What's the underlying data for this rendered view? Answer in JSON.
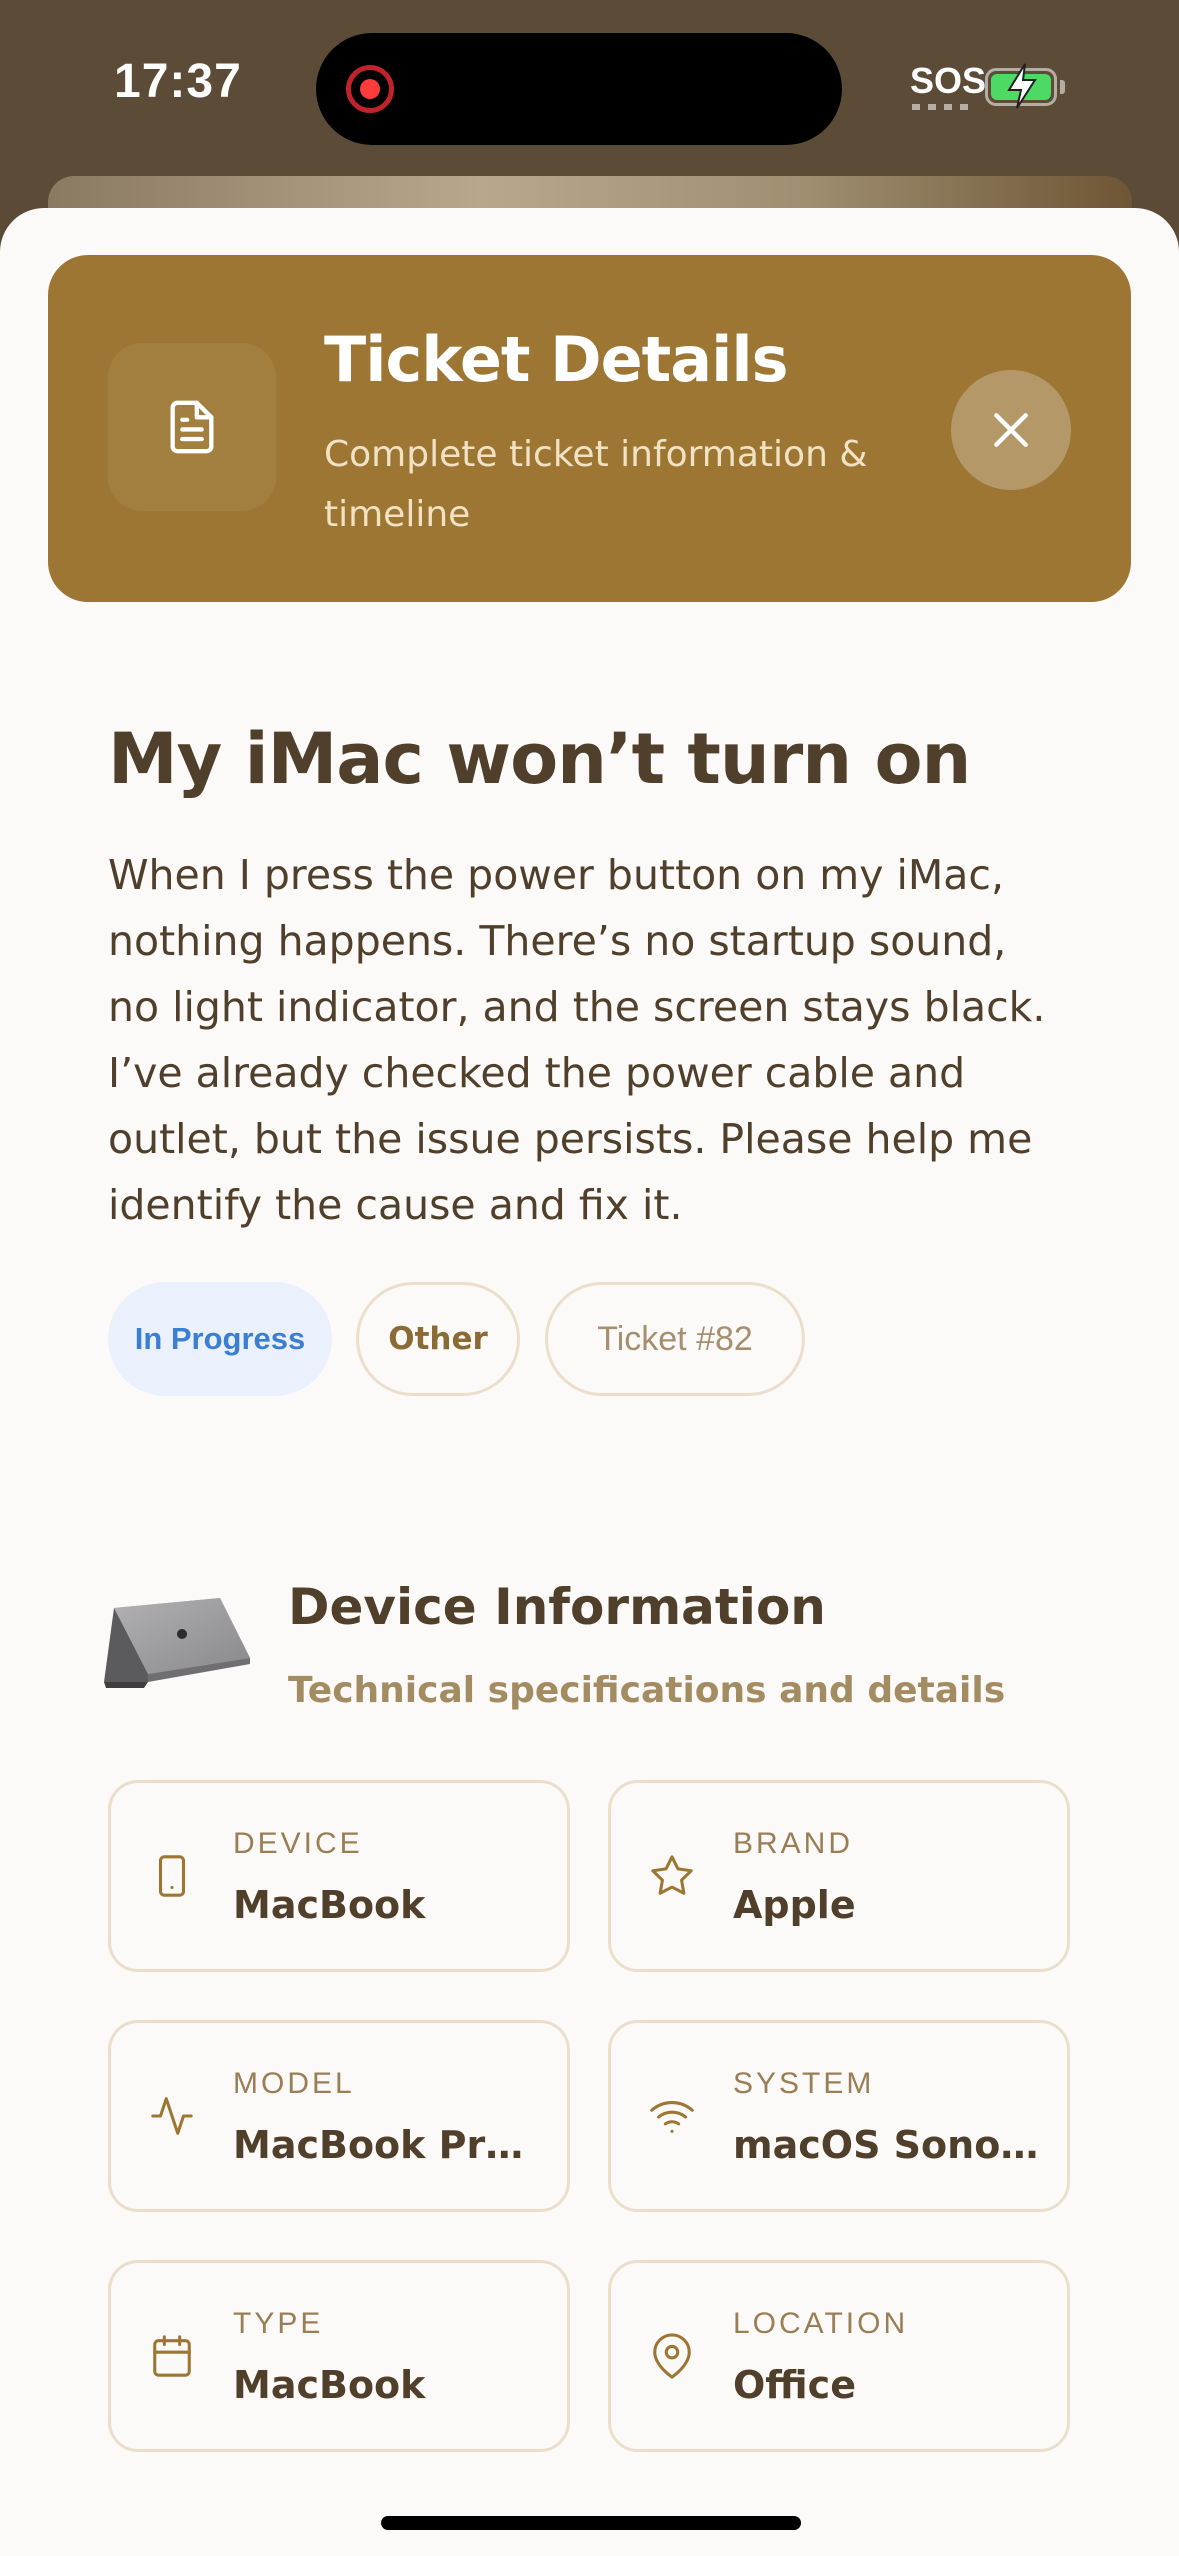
{
  "status_bar": {
    "time": "17:37",
    "carrier": "SOS",
    "battery_level": "charging"
  },
  "header": {
    "title": "Ticket Details",
    "subtitle": "Complete ticket information & timeline",
    "icon": "document-icon",
    "close_icon": "close-icon",
    "background_color": "#9d7634"
  },
  "ticket": {
    "title": "My iMac won’t turn on",
    "description": "When I press the power button on my iMac, nothing happens. There’s no startup sound, no light indicator, and the screen stays black. I’ve already checked the power cable and outlet, but the issue persists. Please help me identify the cause and fix it.",
    "status": "In Progress",
    "category": "Other",
    "number": "Ticket #82"
  },
  "device_section": {
    "title": "Device Information",
    "subtitle": "Technical specifications and details",
    "image": "laptop-image",
    "fields": [
      {
        "label": "DEVICE",
        "value": "MacBook",
        "icon": "phone-icon"
      },
      {
        "label": "BRAND",
        "value": "Apple",
        "icon": "star-icon"
      },
      {
        "label": "MODEL",
        "value": "MacBook Pro...",
        "icon": "activity-icon"
      },
      {
        "label": "SYSTEM",
        "value": "macOS Sonom...",
        "icon": "wifi-icon"
      },
      {
        "label": "TYPE",
        "value": "MacBook",
        "icon": "calendar-icon"
      },
      {
        "label": "LOCATION",
        "value": "Office",
        "icon": "map-pin-icon"
      }
    ]
  },
  "colors": {
    "accent": "#9d7634",
    "text_primary": "#4f3f2b",
    "status_blue": "#3b7fd2"
  }
}
